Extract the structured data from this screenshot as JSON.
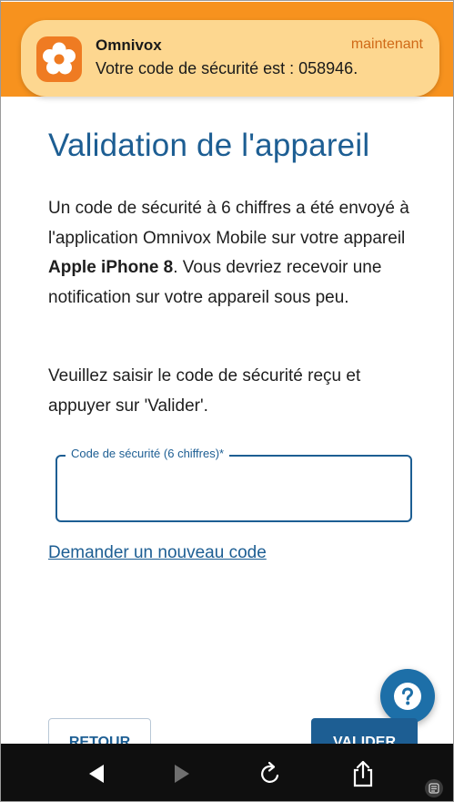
{
  "notification": {
    "app_name": "Omnivox",
    "time": "maintenant",
    "message": "Votre code de sécurité est : 058946.",
    "icon": "omnivox-flower-icon"
  },
  "page": {
    "title": "Validation de l'appareil",
    "paragraph1_before": "Un code de sécurité à 6 chiffres a été envoyé à l'application Omnivox Mobile sur votre appareil ",
    "device_name": "Apple iPhone 8",
    "paragraph1_after": ". Vous devriez recevoir une notification sur votre appareil sous peu.",
    "paragraph2": "Veuillez saisir le code de sécurité reçu et appuyer sur 'Valider'."
  },
  "form": {
    "code_label": "Code de sécurité (6 chiffres)*",
    "code_value": "",
    "new_code_link": "Demander un nouveau code"
  },
  "buttons": {
    "help": "help-question-icon",
    "back": "RETOUR",
    "validate": "VALIDER"
  },
  "browser_bar": {
    "icons": [
      "back-arrow-icon",
      "forward-arrow-icon",
      "reload-icon",
      "share-icon",
      "reader-icon"
    ]
  },
  "colors": {
    "accent": "#1d5e93",
    "notification_bg": "#fdd790",
    "orange": "#f7921e"
  }
}
